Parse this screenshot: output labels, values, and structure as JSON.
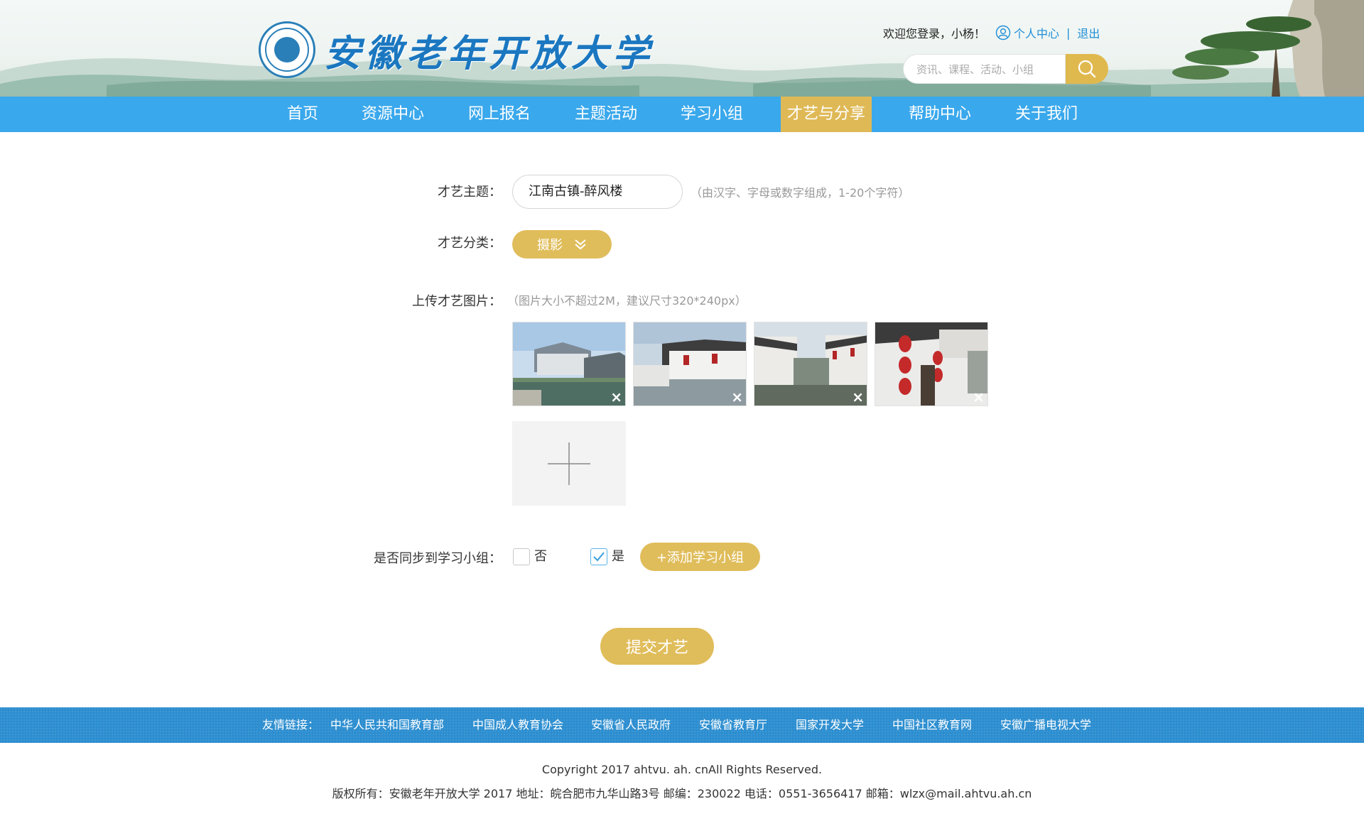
{
  "header": {
    "site_title": "安徽老年开放大学",
    "welcome": "欢迎您登录，小杨！",
    "personal_center": "个人中心",
    "separator": "|",
    "logout": "退出",
    "search_placeholder": "资讯、课程、活动、小组"
  },
  "nav": {
    "items": [
      "首页",
      "资源中心",
      "网上报名",
      "主题活动",
      "学习小组",
      "才艺与分享",
      "帮助中心",
      "关于我们"
    ],
    "active": "才艺与分享"
  },
  "form": {
    "topic_label": "才艺主题：",
    "topic_value": "江南古镇-醉风楼",
    "topic_hint": "（由汉字、字母或数字组成，1-20个字符）",
    "category_label": "才艺分类：",
    "category_value": "摄影",
    "upload_label": "上传才艺图片：",
    "upload_hint": "（图片大小不超过2M，建议尺寸320*240px）",
    "delete_glyph": "×",
    "sync_label": "是否同步到学习小组：",
    "sync_no": "否",
    "sync_yes": "是",
    "sync_selected": "是",
    "add_group_label": "+添加学习小组",
    "submit_label": "提交才艺"
  },
  "footer": {
    "links_label": "友情链接：",
    "links": [
      "中华人民共和国教育部",
      "中国成人教育协会",
      "安徽省人民政府",
      "安徽省教育厅",
      "国家开发大学",
      "中国社区教育网",
      "安徽广播电视大学"
    ],
    "copyright": "Copyright 2017 ahtvu. ah. cnAll Rights Reserved.",
    "info": "版权所有：安徽老年开放大学 2017 地址：皖合肥市九华山路3号 邮编：230022 电话：0551-3656417 邮箱：wlzx@mail.ahtvu.ah.cn"
  },
  "colors": {
    "nav_blue": "#3aa8ec",
    "active_gold": "#dfb956",
    "footer_blue": "#2c8ed0",
    "brand_blue": "#1b77c0"
  }
}
